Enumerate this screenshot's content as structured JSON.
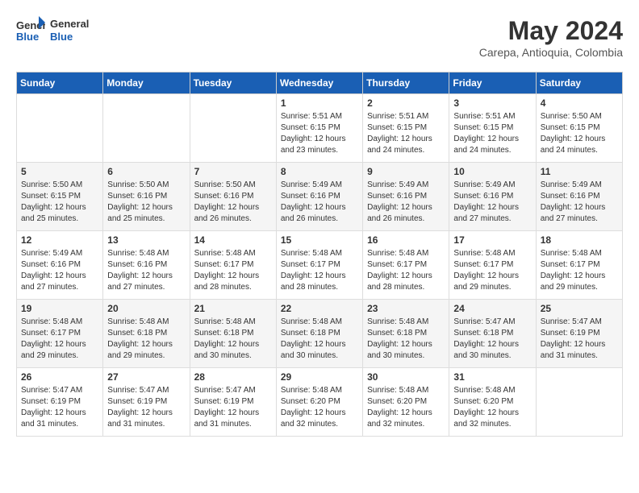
{
  "logo": {
    "line1": "General",
    "line2": "Blue"
  },
  "title": "May 2024",
  "location": "Carepa, Antioquia, Colombia",
  "days_of_week": [
    "Sunday",
    "Monday",
    "Tuesday",
    "Wednesday",
    "Thursday",
    "Friday",
    "Saturday"
  ],
  "weeks": [
    [
      {
        "day": "",
        "content": ""
      },
      {
        "day": "",
        "content": ""
      },
      {
        "day": "",
        "content": ""
      },
      {
        "day": "1",
        "content": "Sunrise: 5:51 AM\nSunset: 6:15 PM\nDaylight: 12 hours\nand 23 minutes."
      },
      {
        "day": "2",
        "content": "Sunrise: 5:51 AM\nSunset: 6:15 PM\nDaylight: 12 hours\nand 24 minutes."
      },
      {
        "day": "3",
        "content": "Sunrise: 5:51 AM\nSunset: 6:15 PM\nDaylight: 12 hours\nand 24 minutes."
      },
      {
        "day": "4",
        "content": "Sunrise: 5:50 AM\nSunset: 6:15 PM\nDaylight: 12 hours\nand 24 minutes."
      }
    ],
    [
      {
        "day": "5",
        "content": "Sunrise: 5:50 AM\nSunset: 6:15 PM\nDaylight: 12 hours\nand 25 minutes."
      },
      {
        "day": "6",
        "content": "Sunrise: 5:50 AM\nSunset: 6:16 PM\nDaylight: 12 hours\nand 25 minutes."
      },
      {
        "day": "7",
        "content": "Sunrise: 5:50 AM\nSunset: 6:16 PM\nDaylight: 12 hours\nand 26 minutes."
      },
      {
        "day": "8",
        "content": "Sunrise: 5:49 AM\nSunset: 6:16 PM\nDaylight: 12 hours\nand 26 minutes."
      },
      {
        "day": "9",
        "content": "Sunrise: 5:49 AM\nSunset: 6:16 PM\nDaylight: 12 hours\nand 26 minutes."
      },
      {
        "day": "10",
        "content": "Sunrise: 5:49 AM\nSunset: 6:16 PM\nDaylight: 12 hours\nand 27 minutes."
      },
      {
        "day": "11",
        "content": "Sunrise: 5:49 AM\nSunset: 6:16 PM\nDaylight: 12 hours\nand 27 minutes."
      }
    ],
    [
      {
        "day": "12",
        "content": "Sunrise: 5:49 AM\nSunset: 6:16 PM\nDaylight: 12 hours\nand 27 minutes."
      },
      {
        "day": "13",
        "content": "Sunrise: 5:48 AM\nSunset: 6:16 PM\nDaylight: 12 hours\nand 27 minutes."
      },
      {
        "day": "14",
        "content": "Sunrise: 5:48 AM\nSunset: 6:17 PM\nDaylight: 12 hours\nand 28 minutes."
      },
      {
        "day": "15",
        "content": "Sunrise: 5:48 AM\nSunset: 6:17 PM\nDaylight: 12 hours\nand 28 minutes."
      },
      {
        "day": "16",
        "content": "Sunrise: 5:48 AM\nSunset: 6:17 PM\nDaylight: 12 hours\nand 28 minutes."
      },
      {
        "day": "17",
        "content": "Sunrise: 5:48 AM\nSunset: 6:17 PM\nDaylight: 12 hours\nand 29 minutes."
      },
      {
        "day": "18",
        "content": "Sunrise: 5:48 AM\nSunset: 6:17 PM\nDaylight: 12 hours\nand 29 minutes."
      }
    ],
    [
      {
        "day": "19",
        "content": "Sunrise: 5:48 AM\nSunset: 6:17 PM\nDaylight: 12 hours\nand 29 minutes."
      },
      {
        "day": "20",
        "content": "Sunrise: 5:48 AM\nSunset: 6:18 PM\nDaylight: 12 hours\nand 29 minutes."
      },
      {
        "day": "21",
        "content": "Sunrise: 5:48 AM\nSunset: 6:18 PM\nDaylight: 12 hours\nand 30 minutes."
      },
      {
        "day": "22",
        "content": "Sunrise: 5:48 AM\nSunset: 6:18 PM\nDaylight: 12 hours\nand 30 minutes."
      },
      {
        "day": "23",
        "content": "Sunrise: 5:48 AM\nSunset: 6:18 PM\nDaylight: 12 hours\nand 30 minutes."
      },
      {
        "day": "24",
        "content": "Sunrise: 5:47 AM\nSunset: 6:18 PM\nDaylight: 12 hours\nand 30 minutes."
      },
      {
        "day": "25",
        "content": "Sunrise: 5:47 AM\nSunset: 6:19 PM\nDaylight: 12 hours\nand 31 minutes."
      }
    ],
    [
      {
        "day": "26",
        "content": "Sunrise: 5:47 AM\nSunset: 6:19 PM\nDaylight: 12 hours\nand 31 minutes."
      },
      {
        "day": "27",
        "content": "Sunrise: 5:47 AM\nSunset: 6:19 PM\nDaylight: 12 hours\nand 31 minutes."
      },
      {
        "day": "28",
        "content": "Sunrise: 5:47 AM\nSunset: 6:19 PM\nDaylight: 12 hours\nand 31 minutes."
      },
      {
        "day": "29",
        "content": "Sunrise: 5:48 AM\nSunset: 6:20 PM\nDaylight: 12 hours\nand 32 minutes."
      },
      {
        "day": "30",
        "content": "Sunrise: 5:48 AM\nSunset: 6:20 PM\nDaylight: 12 hours\nand 32 minutes."
      },
      {
        "day": "31",
        "content": "Sunrise: 5:48 AM\nSunset: 6:20 PM\nDaylight: 12 hours\nand 32 minutes."
      },
      {
        "day": "",
        "content": ""
      }
    ]
  ]
}
